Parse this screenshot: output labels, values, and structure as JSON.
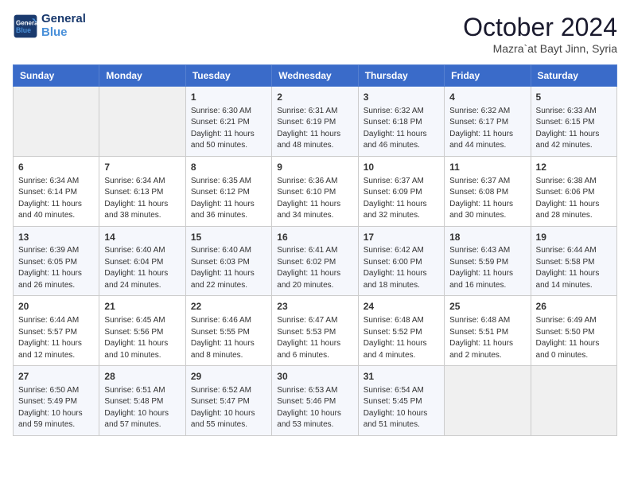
{
  "header": {
    "logo_line1": "General",
    "logo_line2": "Blue",
    "month": "October 2024",
    "location": "Mazra`at Bayt Jinn, Syria"
  },
  "weekdays": [
    "Sunday",
    "Monday",
    "Tuesday",
    "Wednesday",
    "Thursday",
    "Friday",
    "Saturday"
  ],
  "weeks": [
    [
      {
        "day": "",
        "empty": true
      },
      {
        "day": "",
        "empty": true
      },
      {
        "day": "1",
        "sunrise": "6:30 AM",
        "sunset": "6:21 PM",
        "daylight": "11 hours and 50 minutes."
      },
      {
        "day": "2",
        "sunrise": "6:31 AM",
        "sunset": "6:19 PM",
        "daylight": "11 hours and 48 minutes."
      },
      {
        "day": "3",
        "sunrise": "6:32 AM",
        "sunset": "6:18 PM",
        "daylight": "11 hours and 46 minutes."
      },
      {
        "day": "4",
        "sunrise": "6:32 AM",
        "sunset": "6:17 PM",
        "daylight": "11 hours and 44 minutes."
      },
      {
        "day": "5",
        "sunrise": "6:33 AM",
        "sunset": "6:15 PM",
        "daylight": "11 hours and 42 minutes."
      }
    ],
    [
      {
        "day": "6",
        "sunrise": "6:34 AM",
        "sunset": "6:14 PM",
        "daylight": "11 hours and 40 minutes."
      },
      {
        "day": "7",
        "sunrise": "6:34 AM",
        "sunset": "6:13 PM",
        "daylight": "11 hours and 38 minutes."
      },
      {
        "day": "8",
        "sunrise": "6:35 AM",
        "sunset": "6:12 PM",
        "daylight": "11 hours and 36 minutes."
      },
      {
        "day": "9",
        "sunrise": "6:36 AM",
        "sunset": "6:10 PM",
        "daylight": "11 hours and 34 minutes."
      },
      {
        "day": "10",
        "sunrise": "6:37 AM",
        "sunset": "6:09 PM",
        "daylight": "11 hours and 32 minutes."
      },
      {
        "day": "11",
        "sunrise": "6:37 AM",
        "sunset": "6:08 PM",
        "daylight": "11 hours and 30 minutes."
      },
      {
        "day": "12",
        "sunrise": "6:38 AM",
        "sunset": "6:06 PM",
        "daylight": "11 hours and 28 minutes."
      }
    ],
    [
      {
        "day": "13",
        "sunrise": "6:39 AM",
        "sunset": "6:05 PM",
        "daylight": "11 hours and 26 minutes."
      },
      {
        "day": "14",
        "sunrise": "6:40 AM",
        "sunset": "6:04 PM",
        "daylight": "11 hours and 24 minutes."
      },
      {
        "day": "15",
        "sunrise": "6:40 AM",
        "sunset": "6:03 PM",
        "daylight": "11 hours and 22 minutes."
      },
      {
        "day": "16",
        "sunrise": "6:41 AM",
        "sunset": "6:02 PM",
        "daylight": "11 hours and 20 minutes."
      },
      {
        "day": "17",
        "sunrise": "6:42 AM",
        "sunset": "6:00 PM",
        "daylight": "11 hours and 18 minutes."
      },
      {
        "day": "18",
        "sunrise": "6:43 AM",
        "sunset": "5:59 PM",
        "daylight": "11 hours and 16 minutes."
      },
      {
        "day": "19",
        "sunrise": "6:44 AM",
        "sunset": "5:58 PM",
        "daylight": "11 hours and 14 minutes."
      }
    ],
    [
      {
        "day": "20",
        "sunrise": "6:44 AM",
        "sunset": "5:57 PM",
        "daylight": "11 hours and 12 minutes."
      },
      {
        "day": "21",
        "sunrise": "6:45 AM",
        "sunset": "5:56 PM",
        "daylight": "11 hours and 10 minutes."
      },
      {
        "day": "22",
        "sunrise": "6:46 AM",
        "sunset": "5:55 PM",
        "daylight": "11 hours and 8 minutes."
      },
      {
        "day": "23",
        "sunrise": "6:47 AM",
        "sunset": "5:53 PM",
        "daylight": "11 hours and 6 minutes."
      },
      {
        "day": "24",
        "sunrise": "6:48 AM",
        "sunset": "5:52 PM",
        "daylight": "11 hours and 4 minutes."
      },
      {
        "day": "25",
        "sunrise": "6:48 AM",
        "sunset": "5:51 PM",
        "daylight": "11 hours and 2 minutes."
      },
      {
        "day": "26",
        "sunrise": "6:49 AM",
        "sunset": "5:50 PM",
        "daylight": "11 hours and 0 minutes."
      }
    ],
    [
      {
        "day": "27",
        "sunrise": "6:50 AM",
        "sunset": "5:49 PM",
        "daylight": "10 hours and 59 minutes."
      },
      {
        "day": "28",
        "sunrise": "6:51 AM",
        "sunset": "5:48 PM",
        "daylight": "10 hours and 57 minutes."
      },
      {
        "day": "29",
        "sunrise": "6:52 AM",
        "sunset": "5:47 PM",
        "daylight": "10 hours and 55 minutes."
      },
      {
        "day": "30",
        "sunrise": "6:53 AM",
        "sunset": "5:46 PM",
        "daylight": "10 hours and 53 minutes."
      },
      {
        "day": "31",
        "sunrise": "6:54 AM",
        "sunset": "5:45 PM",
        "daylight": "10 hours and 51 minutes."
      },
      {
        "day": "",
        "empty": true
      },
      {
        "day": "",
        "empty": true
      }
    ]
  ]
}
